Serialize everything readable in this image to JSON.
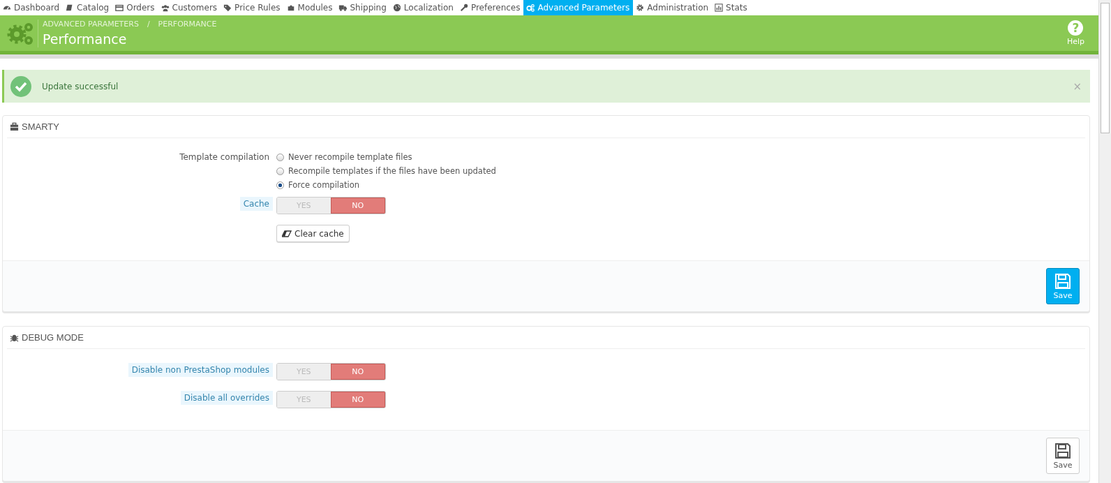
{
  "nav": [
    {
      "label": "Dashboard",
      "selected": false
    },
    {
      "label": "Catalog",
      "selected": false
    },
    {
      "label": "Orders",
      "selected": false
    },
    {
      "label": "Customers",
      "selected": false
    },
    {
      "label": "Price Rules",
      "selected": false
    },
    {
      "label": "Modules",
      "selected": false
    },
    {
      "label": "Shipping",
      "selected": false
    },
    {
      "label": "Localization",
      "selected": false
    },
    {
      "label": "Preferences",
      "selected": false
    },
    {
      "label": "Advanced Parameters",
      "selected": true
    },
    {
      "label": "Administration",
      "selected": false
    },
    {
      "label": "Stats",
      "selected": false
    }
  ],
  "header": {
    "breadcrumb": [
      "ADVANCED PARAMETERS",
      "PERFORMANCE"
    ],
    "separator": "/",
    "title": "Performance",
    "help": {
      "icon": "?",
      "label": "Help"
    }
  },
  "alert": {
    "text": "Update successful",
    "close": "×"
  },
  "panels": [
    {
      "title": "SMARTY",
      "fields": [
        {
          "kind": "radio",
          "label": "Template compilation",
          "hint": false,
          "options": [
            {
              "label": "Never recompile template files",
              "selected": false
            },
            {
              "label": "Recompile templates if the files have been updated",
              "selected": false
            },
            {
              "label": "Force compilation",
              "selected": true
            }
          ]
        },
        {
          "kind": "switch",
          "label": "Cache",
          "hint": true,
          "yes": "YES",
          "no": "NO",
          "on": false
        },
        {
          "kind": "button",
          "label": "Clear cache"
        }
      ],
      "save": {
        "label": "Save",
        "primary": true
      }
    },
    {
      "title": "DEBUG MODE",
      "fields": [
        {
          "kind": "switch",
          "label": "Disable non PrestaShop modules",
          "hint": true,
          "yes": "YES",
          "no": "NO",
          "on": false
        },
        {
          "kind": "switch",
          "label": "Disable all overrides",
          "hint": true,
          "yes": "YES",
          "no": "NO",
          "on": false
        }
      ],
      "save": {
        "label": "Save",
        "primary": false
      }
    }
  ]
}
